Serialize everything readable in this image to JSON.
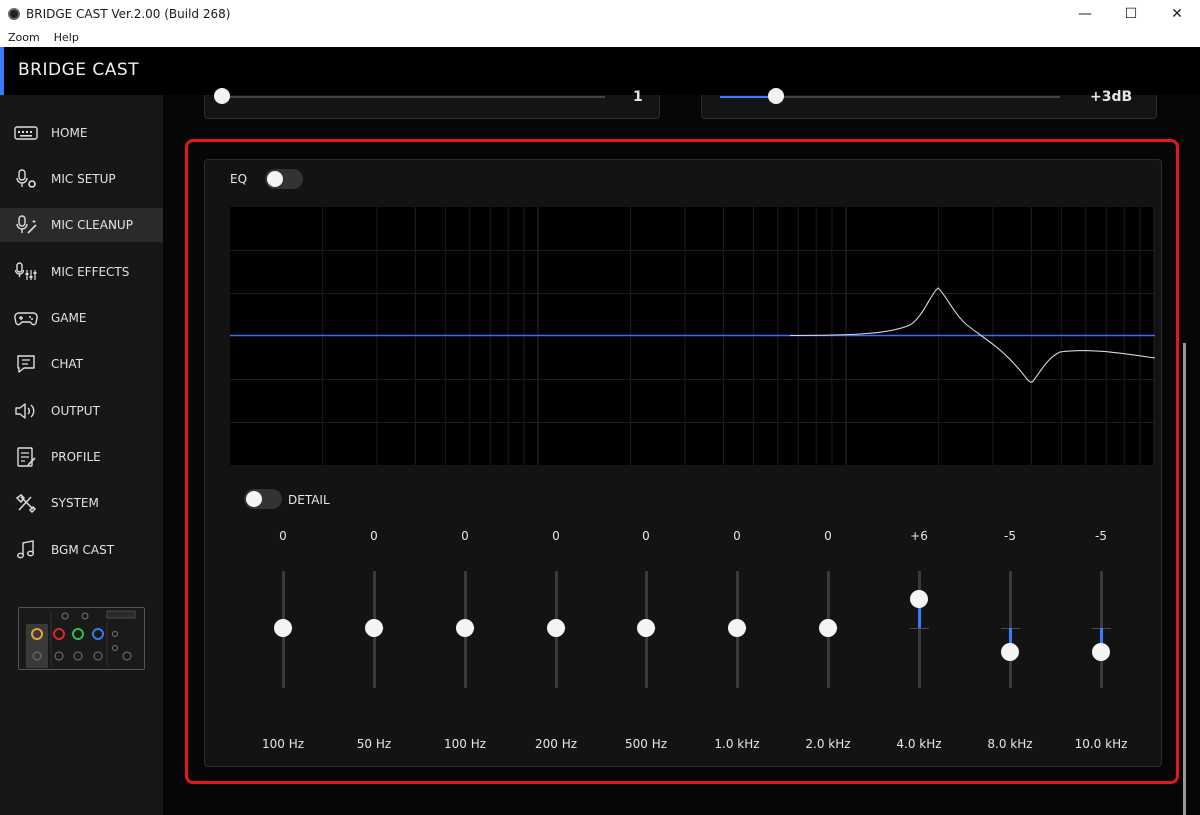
{
  "window": {
    "title": "BRIDGE CAST Ver.2.00 (Build 268)",
    "minimize_glyph": "—",
    "maximize_glyph": "☐",
    "close_glyph": "✕"
  },
  "menu": {
    "items": [
      "Zoom",
      "Help"
    ]
  },
  "app": {
    "brand": "BRIDGE CAST",
    "accent_color": "#3b7bff",
    "highlight_color": "#e31919"
  },
  "sidebar": {
    "items": [
      {
        "label": "HOME",
        "icon": "keyboard-icon",
        "active": false
      },
      {
        "label": "MIC SETUP",
        "icon": "mic-gear-icon",
        "active": false
      },
      {
        "label": "MIC CLEANUP",
        "icon": "mic-wand-icon",
        "active": true
      },
      {
        "label": "MIC EFFECTS",
        "icon": "mic-sliders-icon",
        "active": false
      },
      {
        "label": "GAME",
        "icon": "gamepad-icon",
        "active": false
      },
      {
        "label": "CHAT",
        "icon": "chat-bubble-icon",
        "active": false
      },
      {
        "label": "OUTPUT",
        "icon": "speaker-icon",
        "active": false
      },
      {
        "label": "PROFILE",
        "icon": "profile-doc-icon",
        "active": false
      },
      {
        "label": "SYSTEM",
        "icon": "tools-icon",
        "active": false
      },
      {
        "label": "BGM CAST",
        "icon": "music-note-icon",
        "active": false
      }
    ]
  },
  "top_controls": {
    "left_value": "1",
    "right_value": "+3dB"
  },
  "eq": {
    "label": "EQ",
    "enabled": false,
    "detail_label": "DETAIL",
    "detail_enabled": false,
    "bands": [
      {
        "value": "0",
        "gain": 0,
        "freq": "100 Hz"
      },
      {
        "value": "0",
        "gain": 0,
        "freq": "50 Hz"
      },
      {
        "value": "0",
        "gain": 0,
        "freq": "100 Hz"
      },
      {
        "value": "0",
        "gain": 0,
        "freq": "200 Hz"
      },
      {
        "value": "0",
        "gain": 0,
        "freq": "500 Hz"
      },
      {
        "value": "0",
        "gain": 0,
        "freq": "1.0 kHz"
      },
      {
        "value": "0",
        "gain": 0,
        "freq": "2.0 kHz"
      },
      {
        "value": "+6",
        "gain": 6,
        "freq": "4.0 kHz"
      },
      {
        "value": "-5",
        "gain": -5,
        "freq": "8.0 kHz"
      },
      {
        "value": "-5",
        "gain": -5,
        "freq": "10.0 kHz"
      }
    ]
  }
}
